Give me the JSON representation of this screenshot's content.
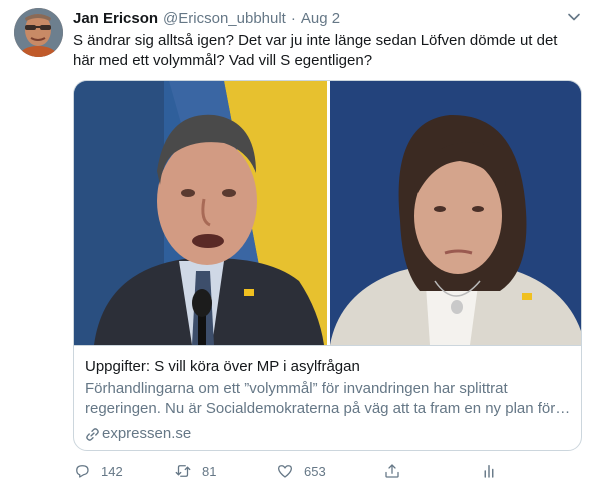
{
  "tweet": {
    "author_name": "Jan Ericson",
    "author_handle": "@Ericson_ubbhult",
    "separator": "·",
    "date": "Aug 2",
    "text": "S ändrar sig alltså igen? Det var ju inte länge sedan Löfven dömde ut det här med ett volymmål? Vad vill S egentligen?"
  },
  "card": {
    "title": "Uppgifter: S vill köra över MP i asylfrågan",
    "description_line1": "Förhandlingarna om ett ”volymmål” för invandringen har splittrat",
    "description_line2": "regeringen. Nu är Socialdemokraterna på väg att ta fram en ny plan för …",
    "domain": "expressen.se"
  },
  "actions": {
    "reply_count": "142",
    "retweet_count": "81",
    "like_count": "653"
  },
  "colors": {
    "text": "#14171a",
    "secondary": "#657786",
    "border": "#ccd6dd",
    "background": "#ffffff"
  },
  "icons": [
    "caret-down-icon",
    "link-icon",
    "reply-icon",
    "retweet-icon",
    "like-icon",
    "share-icon",
    "analytics-icon"
  ]
}
